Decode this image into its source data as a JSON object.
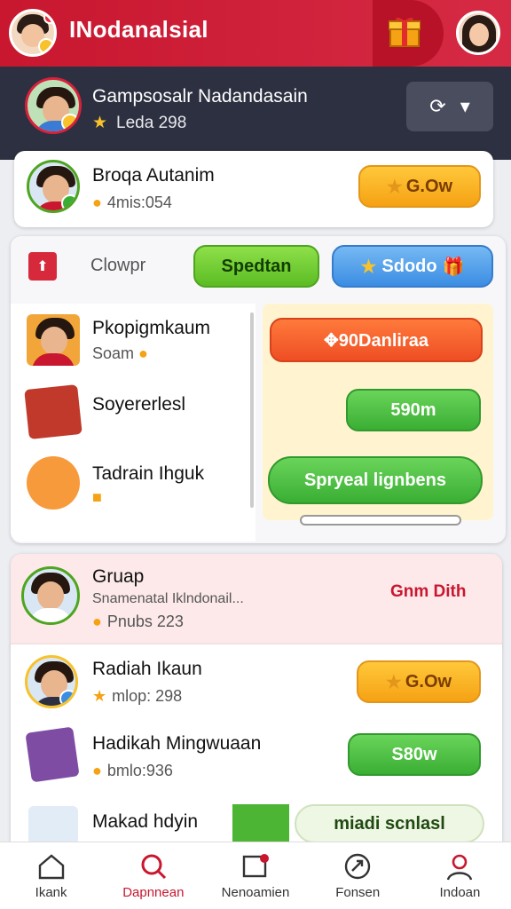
{
  "topbar": {
    "title": "INodanalsial"
  },
  "profile": {
    "name": "Gampsosalr Nadandasain",
    "level": "Leda 298"
  },
  "group_card": {
    "name": "Broqa Autanim",
    "points": "4mis:054",
    "button": "G.Ow"
  },
  "panel": {
    "label": "Clowpr",
    "button_green": "Spedtan",
    "button_blue": "Sdodo",
    "list": [
      {
        "title": "Pkopigmkaum",
        "sub": "Soam"
      },
      {
        "title": "Soyererlesl",
        "sub": ""
      },
      {
        "title": "Tadrain Ihguk",
        "sub": ""
      }
    ],
    "offer_orange": "✥90Danliraa",
    "offer_green": "590m",
    "offer_special": "Spryeal lignbens"
  },
  "group2": {
    "title": "Gruap",
    "sub": "Snamenatal Iklndonail...",
    "points": "Pnubs 223",
    "link": "Gnm Dith"
  },
  "rows": [
    {
      "name": "Radiah Ikaun",
      "sub": "mlop: 298",
      "button": "G.Ow"
    },
    {
      "name": "Hadikah Mingwuaan",
      "sub": "bmlo:936",
      "button": "S80w"
    },
    {
      "name": "Makad hdyin",
      "sub": "",
      "button": "miadi scnlasl"
    }
  ],
  "nav": [
    {
      "label": "Ikank",
      "icon": "home-icon"
    },
    {
      "label": "Dapnnean",
      "icon": "search-icon"
    },
    {
      "label": "Nenoamien",
      "icon": "messages-icon"
    },
    {
      "label": "Fonsen",
      "icon": "share-icon"
    },
    {
      "label": "Indoan",
      "icon": "profile-icon"
    }
  ],
  "colors": {
    "brand": "#c8172f",
    "dark": "#2d3040"
  }
}
